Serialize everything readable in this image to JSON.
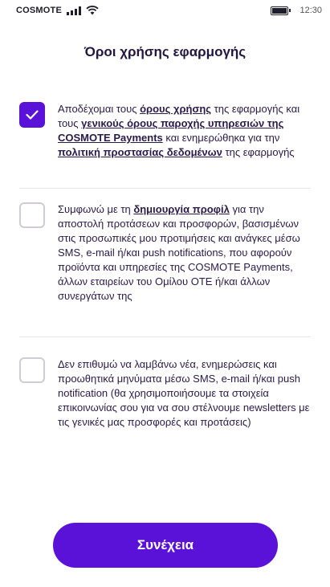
{
  "status_bar": {
    "carrier": "COSMOTE",
    "time": "12:30"
  },
  "page": {
    "title": "Όροι χρήσης εφαρμογής"
  },
  "terms": [
    {
      "checked": true,
      "text_1": "Αποδέχομαι τους ",
      "link_1": "όρους χρήσης",
      "text_2": " της εφαρμογής και τους ",
      "link_2": "γενικούς όρους παροχής υπηρεσιών της COSMOTE Payments",
      "text_3": " και ενημερώθηκα για την ",
      "link_3": "πολιτική προστασίας δεδομένων",
      "text_4": " της εφαρμογής"
    },
    {
      "checked": false,
      "text_1": "Συμφωνώ με τη ",
      "link_1": "δημιουργία προφίλ",
      "text_2": " για την αποστολή προτάσεων και προσφορών, βασισμένων στις προσωπικές μου προτιμήσεις και ανάγκες μέσω SMS, e-mail ή/και push notifications, που αφορούν προϊόντα και υπηρεσίες της COSMOTE Payments, άλλων εταιρείων του Ομίλου ΟΤΕ ή/και άλλων συνεργάτων της"
    },
    {
      "checked": false,
      "text_1": "Δεν επιθυμώ να λαμβάνω νέα, ενημερώσεις και προωθητικά μηνύματα μέσω SMS, e-mail ή/και push notification (θα χρησιμοποιήσουμε τα στοιχεία επικοινωνίας σου για να σου στέλνουμε newsletters με τις γενικές μας προσφορές και προτάσεις)"
    }
  ],
  "actions": {
    "continue_label": "Συνέχεια"
  },
  "icons": {
    "checkmark": "checkmark-icon",
    "signal": "signal-icon",
    "wifi": "wifi-icon",
    "battery": "battery-icon"
  },
  "colors": {
    "accent": "#5b12d8",
    "text": "#2a1a4a",
    "divider": "#e6e3ec",
    "checkbox_border": "#cfcbd8"
  }
}
